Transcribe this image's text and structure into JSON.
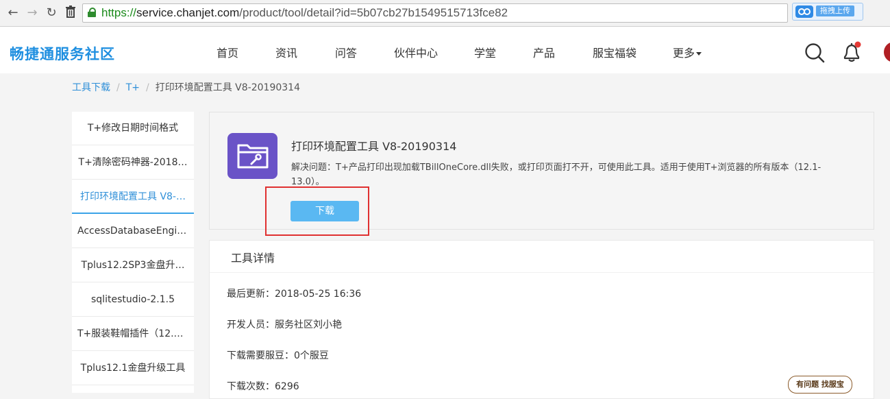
{
  "browser": {
    "url_scheme": "https://",
    "url_host": "service.chanjet.com",
    "url_path": "/product/tool/detail?id=5b07cb27b1549515713fce82",
    "upload_label": "拖拽上传"
  },
  "site": {
    "logo": "畅捷通服务社区",
    "nav": [
      "首页",
      "资讯",
      "问答",
      "伙伴中心",
      "学堂",
      "产品",
      "服宝福袋",
      "更多"
    ]
  },
  "breadcrumb": [
    "工具下载",
    "T+",
    "打印环境配置工具 V8-20190314"
  ],
  "sidebar": {
    "items": [
      "T+修改日期时间格式",
      "T+清除密码神器-2018…",
      "打印环境配置工具 V8-…",
      "AccessDatabaseEngin…",
      "Tplus12.2SP3金盘升…",
      "sqlitestudio-2.1.5",
      "T+服装鞋帽插件（12.1）",
      "Tplus12.1金盘升级工具"
    ],
    "active_index": 2
  },
  "tool": {
    "title": "打印环境配置工具 V8-20190314",
    "description": "解决问题：T+产品打印出现加载TBillOneCore.dll失败，或打印页面打不开，可使用此工具。适用于使用T+浏览器的所有版本（12.1-13.0）。",
    "download_label": "下载",
    "icon": "folder-wrench-icon"
  },
  "details": {
    "title": "工具详情",
    "rows": [
      "最后更新：2018-05-25 16:36",
      "开发人员：服务社区刘小艳",
      "下载需要服豆：0个服豆",
      "下载次数：6296"
    ]
  },
  "help_badge": "有问题 找服宝",
  "colors": {
    "brand": "#1f8fe0",
    "accent": "#5ab8f2",
    "icon_bg": "#6a53c7",
    "highlight": "#e03030"
  }
}
